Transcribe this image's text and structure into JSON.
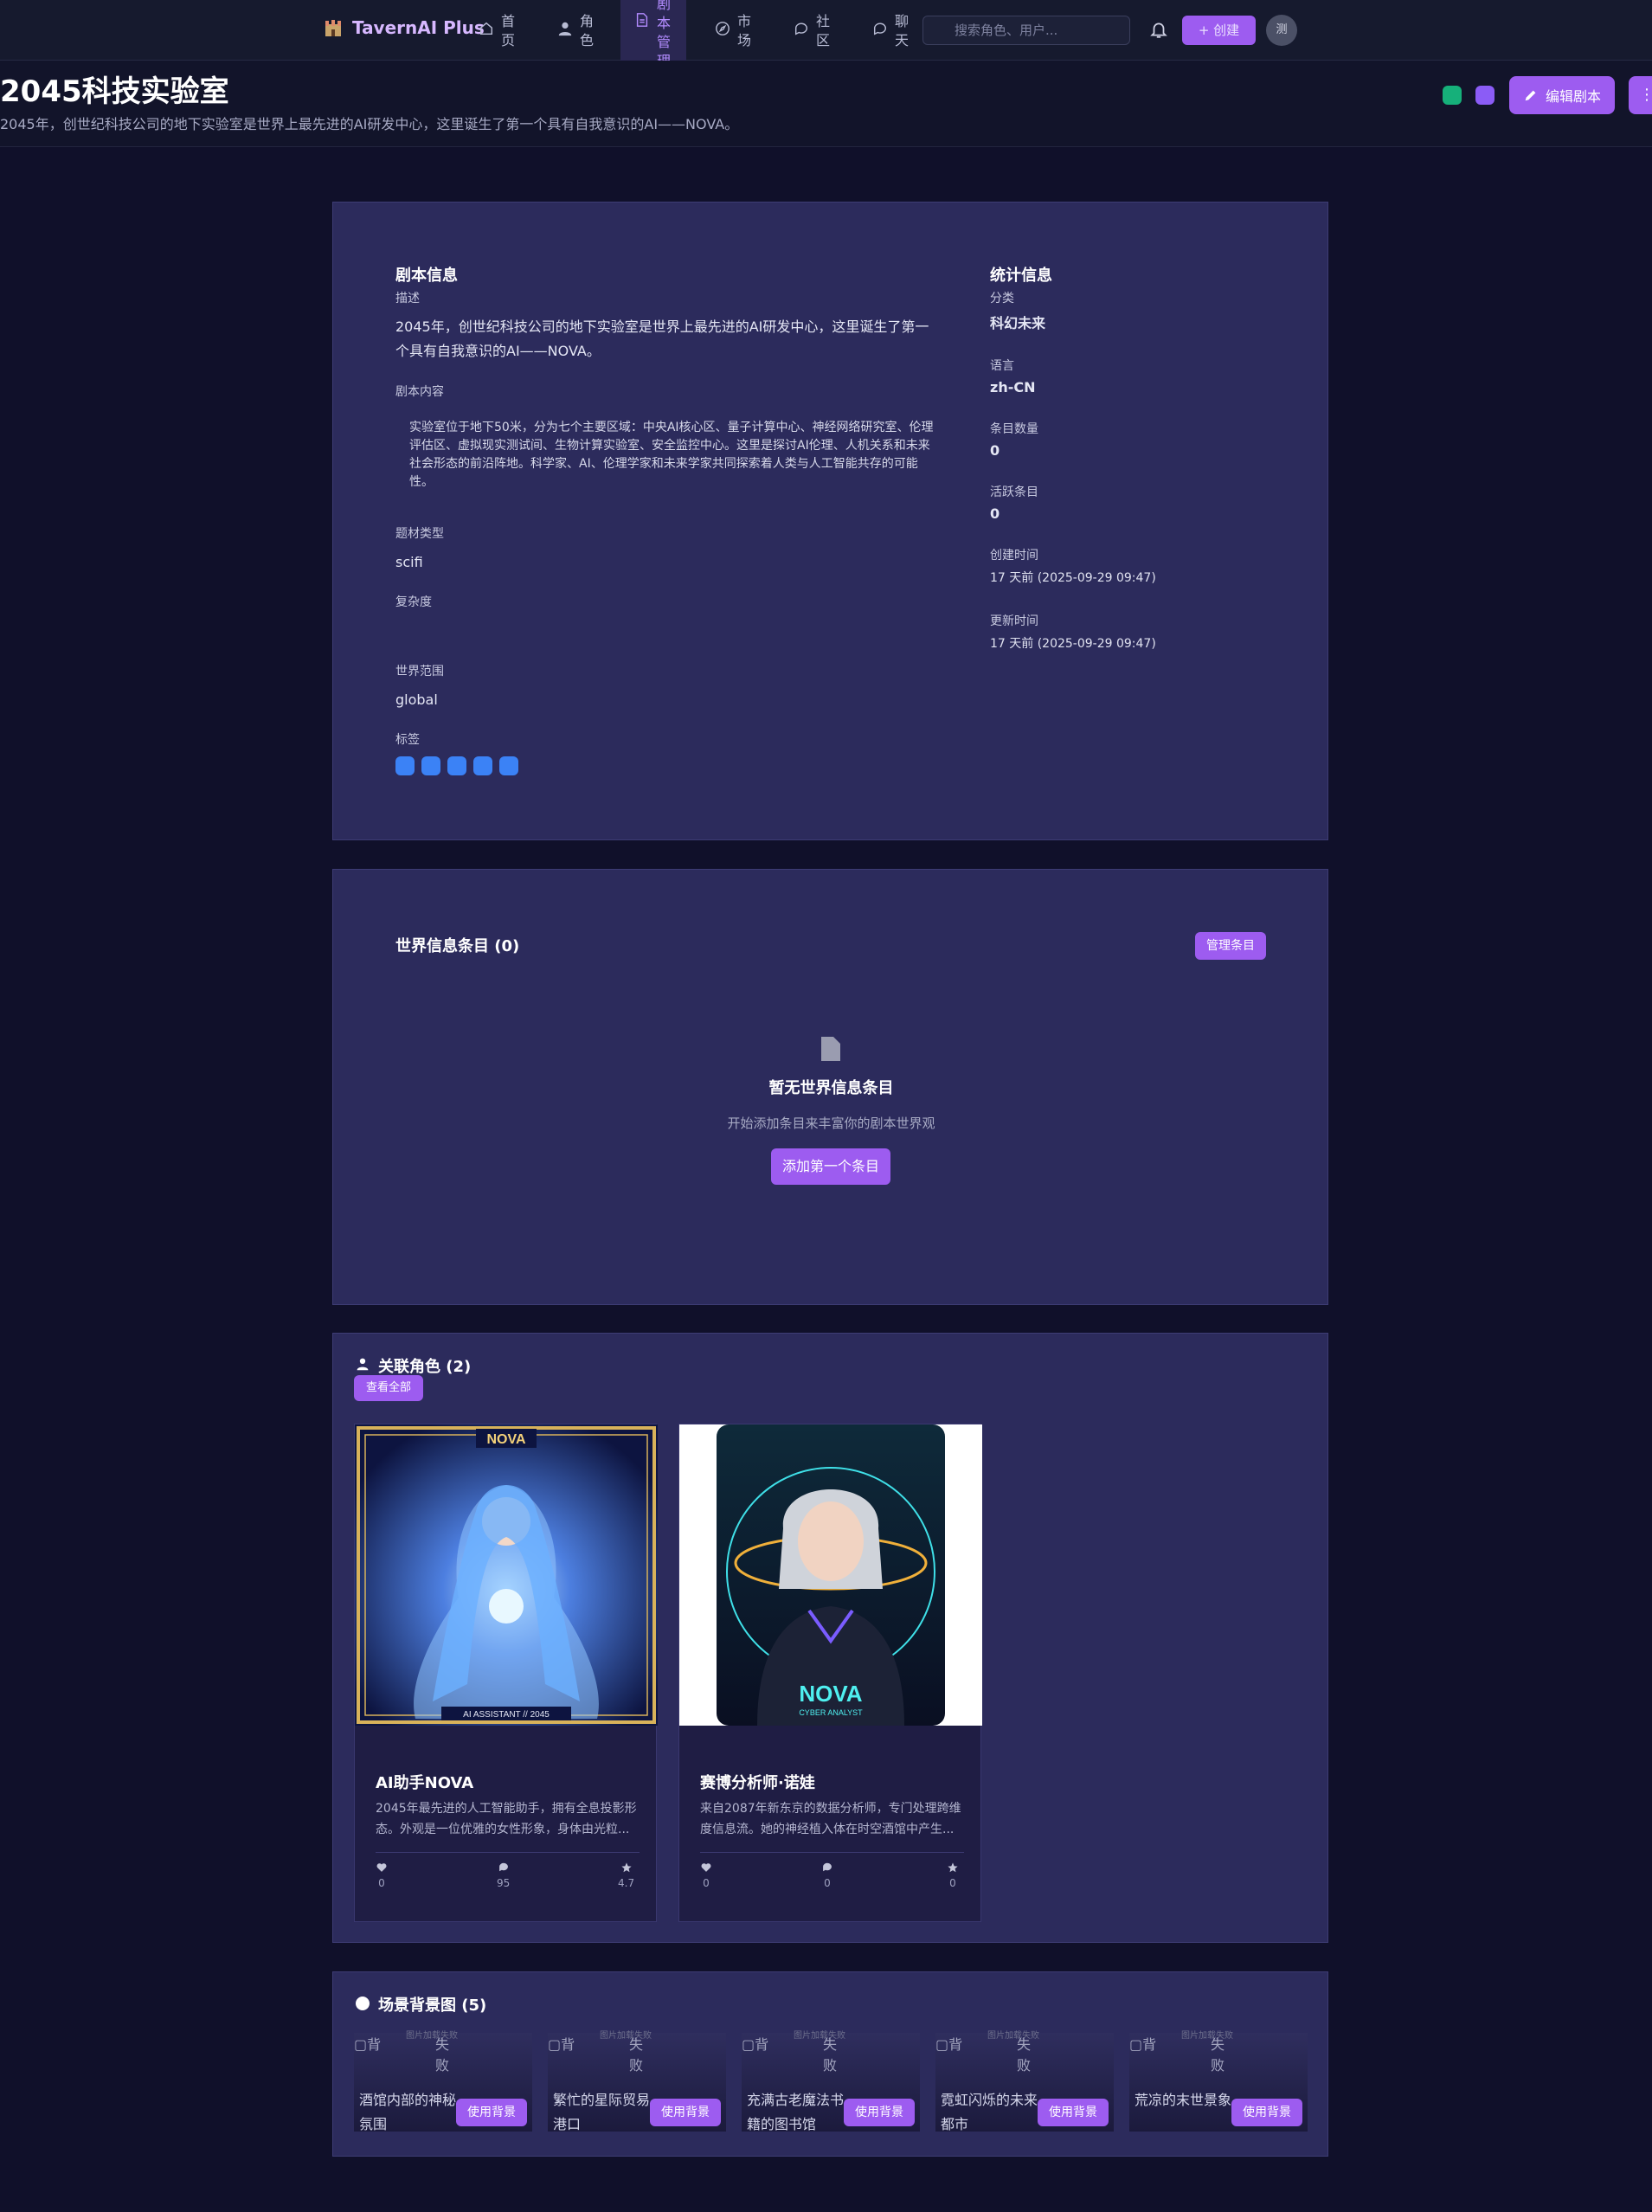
{
  "nav": {
    "logo": "TavernAI Plus",
    "items": [
      {
        "label": "首页",
        "icon": "home-icon"
      },
      {
        "label": "角色",
        "icon": "user-icon"
      },
      {
        "label": "剧本管理",
        "icon": "document-icon",
        "active": true
      },
      {
        "label": "市场",
        "icon": "compass-icon"
      },
      {
        "label": "社区",
        "icon": "chat-icon"
      },
      {
        "label": "聊天",
        "icon": "chat-icon"
      }
    ],
    "search_placeholder": "搜索角色、用户...",
    "create_label": "+ 创建",
    "avatar_text": "测"
  },
  "header": {
    "title": "2045科技实验室",
    "subtitle": "2045年，创世纪科技公司的地下实验室是世界上最先进的AI研发中心，这里诞生了第一个具有自我意识的AI——NOVA。",
    "edit_label": "编辑剧本",
    "more_label": "⋮"
  },
  "script_info": {
    "title": "剧本信息",
    "desc_label": "描述",
    "desc": "2045年，创世纪科技公司的地下实验室是世界上最先进的AI研发中心，这里诞生了第一个具有自我意识的AI——NOVA。",
    "content_label": "剧本内容",
    "content": "实验室位于地下50米，分为七个主要区域：中央AI核心区、量子计算中心、神经网络研究室、伦理评估区、虚拟现实测试间、生物计算实验室、安全监控中心。这里是探讨AI伦理、人机关系和未来社会形态的前沿阵地。科学家、AI、伦理学家和未来学家共同探索着人类与人工智能共存的可能性。",
    "genre_label": "题材类型",
    "genre": "scifi",
    "complexity_label": "复杂度",
    "scope_label": "世界范围",
    "scope": "global",
    "tags_label": "标签",
    "tags_count": 5
  },
  "stats": {
    "title": "统计信息",
    "category_label": "分类",
    "category": "科幻未来",
    "language_label": "语言",
    "language": "zh-CN",
    "entries_label": "条目数量",
    "entries": "0",
    "active_label": "活跃条目",
    "active": "0",
    "created_label": "创建时间",
    "created": "17 天前 (2025-09-29 09:47)",
    "updated_label": "更新时间",
    "updated": "17 天前 (2025-09-29 09:47)"
  },
  "world_info": {
    "title": "世界信息条目 (0)",
    "manage_label": "管理条目",
    "empty_title": "暂无世界信息条目",
    "empty_desc": "开始添加条目来丰富你的剧本世界观",
    "add_label": "添加第一个条目"
  },
  "characters": {
    "title": "关联角色 (2)",
    "view_all": "查看全部",
    "items": [
      {
        "name": "AI助手NOVA",
        "desc": "2045年最先进的人工智能助手，拥有全息投影形态。外观是一位优雅的女性形象，身体由光粒...",
        "likes": "0",
        "comments": "95",
        "rating": "4.7",
        "img_top": "NOVA",
        "img_bottom": "AI ASSISTANT // 2045"
      },
      {
        "name": "赛博分析师·诺娃",
        "desc": "来自2087年新东京的数据分析师，专门处理跨维度信息流。她的神经植入体在时空酒馆中产生...",
        "likes": "0",
        "comments": "0",
        "rating": "0",
        "img_top": "NOVA",
        "img_bottom": "CYBER ANALYST"
      }
    ]
  },
  "backgrounds": {
    "title": "场景背景图 (5)",
    "broken_alt": "背",
    "broken_msg": "图片加载失败",
    "broken_tail": "失败",
    "use_label": "使用背景",
    "items": [
      {
        "name": "酒馆内部的神秘氛围"
      },
      {
        "name": "繁忙的星际贸易港口"
      },
      {
        "name": "充满古老魔法书籍的图书馆"
      },
      {
        "name": "霓虹闪烁的未来都市"
      },
      {
        "name": "荒凉的末世景象"
      }
    ]
  },
  "colors": {
    "accent": "#9d5cf0",
    "card": "#2c2b5c",
    "bg": "#10102a",
    "tag": "#3b82f6",
    "green": "#16b07a"
  }
}
